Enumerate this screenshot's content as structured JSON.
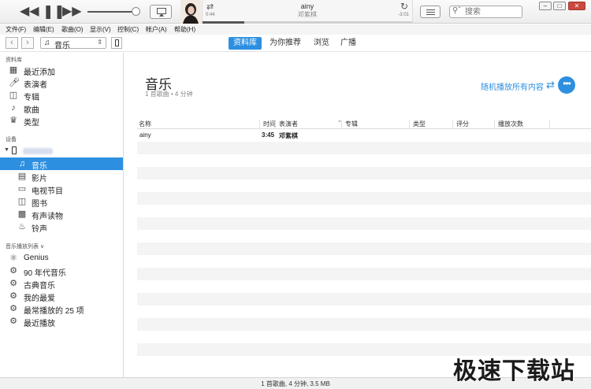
{
  "player": {
    "volume_fraction": 0.92,
    "track_title": "ainy",
    "track_artist": "邓紫棋",
    "elapsed": "0:44",
    "remaining": "-3:01",
    "progress_fraction": 0.2,
    "search_placeholder": "搜索"
  },
  "menubar": {
    "items": [
      {
        "label": "文件(F)"
      },
      {
        "label": "编辑(E)"
      },
      {
        "label": "歌曲(O)"
      },
      {
        "label": "显示(V)"
      },
      {
        "label": "控制(C)"
      },
      {
        "label": "帐户(A)"
      },
      {
        "label": "帮助(H)"
      }
    ]
  },
  "navbar": {
    "media_selector": "音乐",
    "tabs": [
      {
        "label": "资料库",
        "active": true
      },
      {
        "label": "为你推荐",
        "active": false
      },
      {
        "label": "浏览",
        "active": false
      },
      {
        "label": "广播",
        "active": false
      }
    ]
  },
  "sidebar": {
    "library_heading": "资料库",
    "library_items": [
      {
        "label": "最近添加",
        "icon": "grid-icon"
      },
      {
        "label": "表演者",
        "icon": "microphone-icon"
      },
      {
        "label": "专辑",
        "icon": "album-icon"
      },
      {
        "label": "歌曲",
        "icon": "note-icon"
      },
      {
        "label": "类型",
        "icon": "genre-icon"
      }
    ],
    "devices_heading": "设备",
    "device_items": [
      {
        "label": "音乐",
        "icon": "note-icon",
        "selected": true
      },
      {
        "label": "影片",
        "icon": "film-icon",
        "selected": false
      },
      {
        "label": "电视节目",
        "icon": "tv-icon",
        "selected": false
      },
      {
        "label": "图书",
        "icon": "book-icon",
        "selected": false
      },
      {
        "label": "有声读物",
        "icon": "audiobook-icon",
        "selected": false
      },
      {
        "label": "铃声",
        "icon": "bell-icon",
        "selected": false
      }
    ],
    "playlists_heading": "音乐播放列表 ∨",
    "playlist_items": [
      {
        "label": "Genius",
        "icon": "genius-icon"
      },
      {
        "label": "90 年代音乐",
        "icon": "gear-icon"
      },
      {
        "label": "古典音乐",
        "icon": "gear-icon"
      },
      {
        "label": "我的最爱",
        "icon": "gear-icon"
      },
      {
        "label": "最常播放的 25 项",
        "icon": "gear-icon"
      },
      {
        "label": "最近播放",
        "icon": "gear-icon"
      }
    ]
  },
  "content": {
    "title": "音乐",
    "subtitle": "1 首歌曲 • 4 分钟",
    "shuffle_all": "随机播放所有内容",
    "columns": [
      "名称",
      "时间",
      "表演者",
      "专辑",
      "类型",
      "评分",
      "播放次数"
    ],
    "rows": [
      {
        "name": "ainy",
        "time": "3:45",
        "artist": "邓紫棋",
        "album": "",
        "genre": "",
        "rating": "",
        "plays": ""
      }
    ]
  },
  "status": {
    "text": "1 首歌曲, 4 分钟, 3.5 MB"
  },
  "watermark": "极速下载站",
  "colors": {
    "accent": "#2d8fe0"
  }
}
